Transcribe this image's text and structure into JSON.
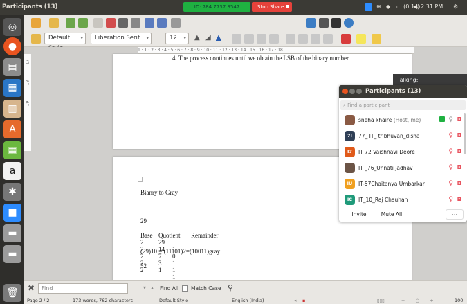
{
  "window": {
    "title": "Participants (13)"
  },
  "zoom_bar": {
    "meeting_id": "ID: 784 7737 3547",
    "stop_share": "Stop Share"
  },
  "tray": {
    "clock": "2:31 PM",
    "battery": "(0:14)"
  },
  "toolbar": {
    "paragraph_style": "Default Style",
    "font_name": "Liberation Serif",
    "font_size": "12"
  },
  "ruler": {
    "ticks": "1 · 1 · 2 · 3 · 4 · 5 · 6 · 7 · 8 · 9 · 10 · 11 · 12 · 13 · 14 · 15 · 16 · 17 · 18"
  },
  "ruler_v": {
    "ticks": [
      "17",
      "18",
      "19"
    ]
  },
  "document": {
    "page1_line": "4.   The process continues until we obtain the LSB of the binary number",
    "page2": {
      "heading": "Bianry to Gray",
      "number": "29",
      "table_header": [
        "Base",
        "Quotient",
        "Remainder"
      ],
      "rows": [
        [
          "2",
          "29",
          ""
        ],
        [
          "2",
          "14",
          "1"
        ],
        [
          "2",
          "7",
          "0"
        ],
        [
          "2",
          "3",
          "1"
        ],
        [
          "2",
          "1",
          "1"
        ],
        [
          "",
          "",
          "1"
        ]
      ],
      "binary": "11101",
      "gray": "10011",
      "result": "(29)10 = (11101)2=(10011)gray",
      "next_number": "52"
    }
  },
  "talking": "Talking:",
  "participants": {
    "title": "Participants (13)",
    "search_placeholder": "Find a participant",
    "list": [
      {
        "name": "sneha khaire",
        "tag": "(Host, me)",
        "initials": "",
        "color": "#8a5a44"
      },
      {
        "name": "77_ IT_ tribhuvan_disha",
        "tag": "",
        "initials": "7I",
        "color": "#2f3f56"
      },
      {
        "name": "IT 72 Vaishnavi Deore",
        "tag": "",
        "initials": "I7",
        "color": "#e05a1a"
      },
      {
        "name": "IT _76_Unnati Jadhav",
        "tag": "",
        "initials": "",
        "color": "#6b5446"
      },
      {
        "name": "IT-57Chaitanya Umbarkar",
        "tag": "",
        "initials": "IU",
        "color": "#f0a020"
      },
      {
        "name": "IT_10_Raj Chauhan",
        "tag": "",
        "initials": "IC",
        "color": "#1f9a7a"
      }
    ],
    "invite_label": "Invite",
    "mute_all_label": "Mute All",
    "more_label": "···"
  },
  "findbar": {
    "placeholder": "Find",
    "find_all": "Find All",
    "match_case": "Match Case"
  },
  "status": {
    "page": "Page 2 / 2",
    "words": "173 words, 762 characters",
    "style": "Default Style",
    "language": "English (India)",
    "zoom": "100"
  },
  "colors": {
    "zoom_green": "#1fb141",
    "stop_red": "#e6423b",
    "launcher_bg": "#2f2e2b",
    "topbar_bg": "#3b3a35"
  }
}
